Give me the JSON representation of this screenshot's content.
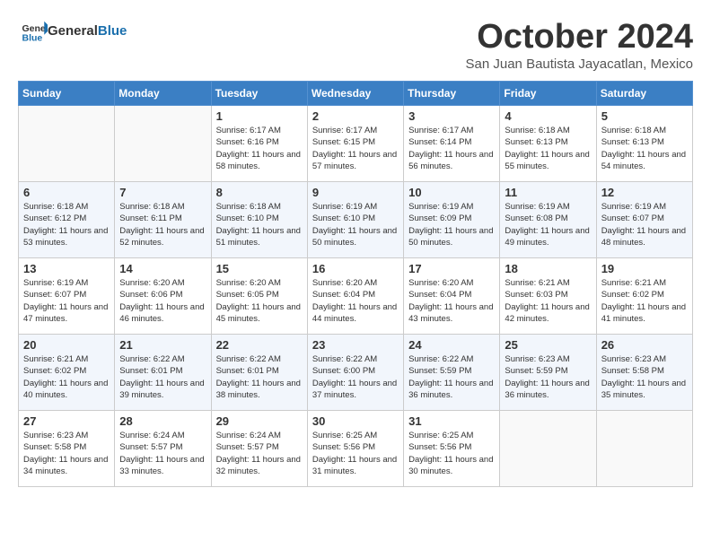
{
  "logo": {
    "general": "General",
    "blue": "Blue"
  },
  "title": "October 2024",
  "location": "San Juan Bautista Jayacatlan, Mexico",
  "days_header": [
    "Sunday",
    "Monday",
    "Tuesday",
    "Wednesday",
    "Thursday",
    "Friday",
    "Saturday"
  ],
  "weeks": [
    [
      {
        "day": "",
        "info": ""
      },
      {
        "day": "",
        "info": ""
      },
      {
        "day": "1",
        "info": "Sunrise: 6:17 AM\nSunset: 6:16 PM\nDaylight: 11 hours and 58 minutes."
      },
      {
        "day": "2",
        "info": "Sunrise: 6:17 AM\nSunset: 6:15 PM\nDaylight: 11 hours and 57 minutes."
      },
      {
        "day": "3",
        "info": "Sunrise: 6:17 AM\nSunset: 6:14 PM\nDaylight: 11 hours and 56 minutes."
      },
      {
        "day": "4",
        "info": "Sunrise: 6:18 AM\nSunset: 6:13 PM\nDaylight: 11 hours and 55 minutes."
      },
      {
        "day": "5",
        "info": "Sunrise: 6:18 AM\nSunset: 6:13 PM\nDaylight: 11 hours and 54 minutes."
      }
    ],
    [
      {
        "day": "6",
        "info": "Sunrise: 6:18 AM\nSunset: 6:12 PM\nDaylight: 11 hours and 53 minutes."
      },
      {
        "day": "7",
        "info": "Sunrise: 6:18 AM\nSunset: 6:11 PM\nDaylight: 11 hours and 52 minutes."
      },
      {
        "day": "8",
        "info": "Sunrise: 6:18 AM\nSunset: 6:10 PM\nDaylight: 11 hours and 51 minutes."
      },
      {
        "day": "9",
        "info": "Sunrise: 6:19 AM\nSunset: 6:10 PM\nDaylight: 11 hours and 50 minutes."
      },
      {
        "day": "10",
        "info": "Sunrise: 6:19 AM\nSunset: 6:09 PM\nDaylight: 11 hours and 50 minutes."
      },
      {
        "day": "11",
        "info": "Sunrise: 6:19 AM\nSunset: 6:08 PM\nDaylight: 11 hours and 49 minutes."
      },
      {
        "day": "12",
        "info": "Sunrise: 6:19 AM\nSunset: 6:07 PM\nDaylight: 11 hours and 48 minutes."
      }
    ],
    [
      {
        "day": "13",
        "info": "Sunrise: 6:19 AM\nSunset: 6:07 PM\nDaylight: 11 hours and 47 minutes."
      },
      {
        "day": "14",
        "info": "Sunrise: 6:20 AM\nSunset: 6:06 PM\nDaylight: 11 hours and 46 minutes."
      },
      {
        "day": "15",
        "info": "Sunrise: 6:20 AM\nSunset: 6:05 PM\nDaylight: 11 hours and 45 minutes."
      },
      {
        "day": "16",
        "info": "Sunrise: 6:20 AM\nSunset: 6:04 PM\nDaylight: 11 hours and 44 minutes."
      },
      {
        "day": "17",
        "info": "Sunrise: 6:20 AM\nSunset: 6:04 PM\nDaylight: 11 hours and 43 minutes."
      },
      {
        "day": "18",
        "info": "Sunrise: 6:21 AM\nSunset: 6:03 PM\nDaylight: 11 hours and 42 minutes."
      },
      {
        "day": "19",
        "info": "Sunrise: 6:21 AM\nSunset: 6:02 PM\nDaylight: 11 hours and 41 minutes."
      }
    ],
    [
      {
        "day": "20",
        "info": "Sunrise: 6:21 AM\nSunset: 6:02 PM\nDaylight: 11 hours and 40 minutes."
      },
      {
        "day": "21",
        "info": "Sunrise: 6:22 AM\nSunset: 6:01 PM\nDaylight: 11 hours and 39 minutes."
      },
      {
        "day": "22",
        "info": "Sunrise: 6:22 AM\nSunset: 6:01 PM\nDaylight: 11 hours and 38 minutes."
      },
      {
        "day": "23",
        "info": "Sunrise: 6:22 AM\nSunset: 6:00 PM\nDaylight: 11 hours and 37 minutes."
      },
      {
        "day": "24",
        "info": "Sunrise: 6:22 AM\nSunset: 5:59 PM\nDaylight: 11 hours and 36 minutes."
      },
      {
        "day": "25",
        "info": "Sunrise: 6:23 AM\nSunset: 5:59 PM\nDaylight: 11 hours and 36 minutes."
      },
      {
        "day": "26",
        "info": "Sunrise: 6:23 AM\nSunset: 5:58 PM\nDaylight: 11 hours and 35 minutes."
      }
    ],
    [
      {
        "day": "27",
        "info": "Sunrise: 6:23 AM\nSunset: 5:58 PM\nDaylight: 11 hours and 34 minutes."
      },
      {
        "day": "28",
        "info": "Sunrise: 6:24 AM\nSunset: 5:57 PM\nDaylight: 11 hours and 33 minutes."
      },
      {
        "day": "29",
        "info": "Sunrise: 6:24 AM\nSunset: 5:57 PM\nDaylight: 11 hours and 32 minutes."
      },
      {
        "day": "30",
        "info": "Sunrise: 6:25 AM\nSunset: 5:56 PM\nDaylight: 11 hours and 31 minutes."
      },
      {
        "day": "31",
        "info": "Sunrise: 6:25 AM\nSunset: 5:56 PM\nDaylight: 11 hours and 30 minutes."
      },
      {
        "day": "",
        "info": ""
      },
      {
        "day": "",
        "info": ""
      }
    ]
  ]
}
